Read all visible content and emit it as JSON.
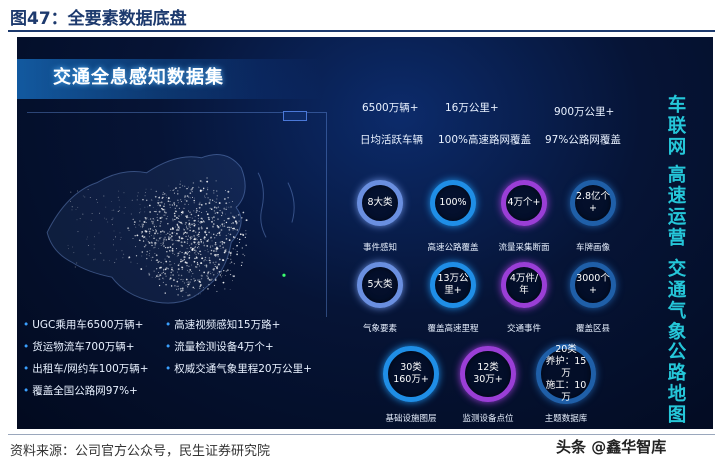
{
  "figure": {
    "title": "图47：全要素数据底盘",
    "source": "资料来源：公司官方公众号，民生证券研究院",
    "watermark": "头条 @鑫华智库"
  },
  "panel": {
    "heading": "交通全息感知数据集",
    "features": [
      "UGC乘用车6500万辆+",
      "高速视频感知15万路+",
      "货运物流车700万辆+",
      "流量检测设备4万个+",
      "出租车/网约车100万辆+",
      "权威交通气象里程20万公里+",
      "覆盖全国公路网97%+"
    ],
    "stats": [
      {
        "value": "6500万辆+",
        "label": "日均活跃车辆"
      },
      {
        "value": "16万公里+",
        "label": "100%高速路网覆盖"
      },
      {
        "value": "900万公里+",
        "label": "97%公路网覆盖"
      }
    ],
    "rings": [
      {
        "value": "8大类",
        "label": "事件感知",
        "color": "#6a8fe0"
      },
      {
        "value": "100%",
        "label": "高速公路覆盖",
        "color": "#1f8ee6"
      },
      {
        "value": "4万个+",
        "label": "流量采集断面",
        "color": "#9a3ed6"
      },
      {
        "value": "2.8亿个+",
        "label": "车牌画像",
        "color": "#1f5fa8"
      },
      {
        "value": "5大类",
        "label": "气象要素",
        "color": "#6a8fe0"
      },
      {
        "value": "13万公里+",
        "label": "覆盖高速里程",
        "color": "#1f8ee6"
      },
      {
        "value": "4万件/年",
        "label": "交通事件",
        "color": "#9a3ed6"
      },
      {
        "value": "3000个+",
        "label": "覆盖区县",
        "color": "#1f5fa8"
      },
      {
        "value": "30类\n160万+",
        "label": "基础设施图层",
        "color": "#1f8ee6"
      },
      {
        "value": "12类\n30万+",
        "label": "监测设备点位",
        "color": "#9a3ed6"
      },
      {
        "value": "20类\n养护：15万\n施工：10万",
        "label": "主题数据库",
        "color": "#1f5fa8"
      }
    ],
    "side_columns": [
      "车联网",
      "高速运营",
      "交通气象",
      "公路地图"
    ]
  },
  "icons": {
    "map": "china-traffic-map-icon",
    "bullet": "bullet-dot-icon",
    "ring": "progress-ring-icon"
  }
}
